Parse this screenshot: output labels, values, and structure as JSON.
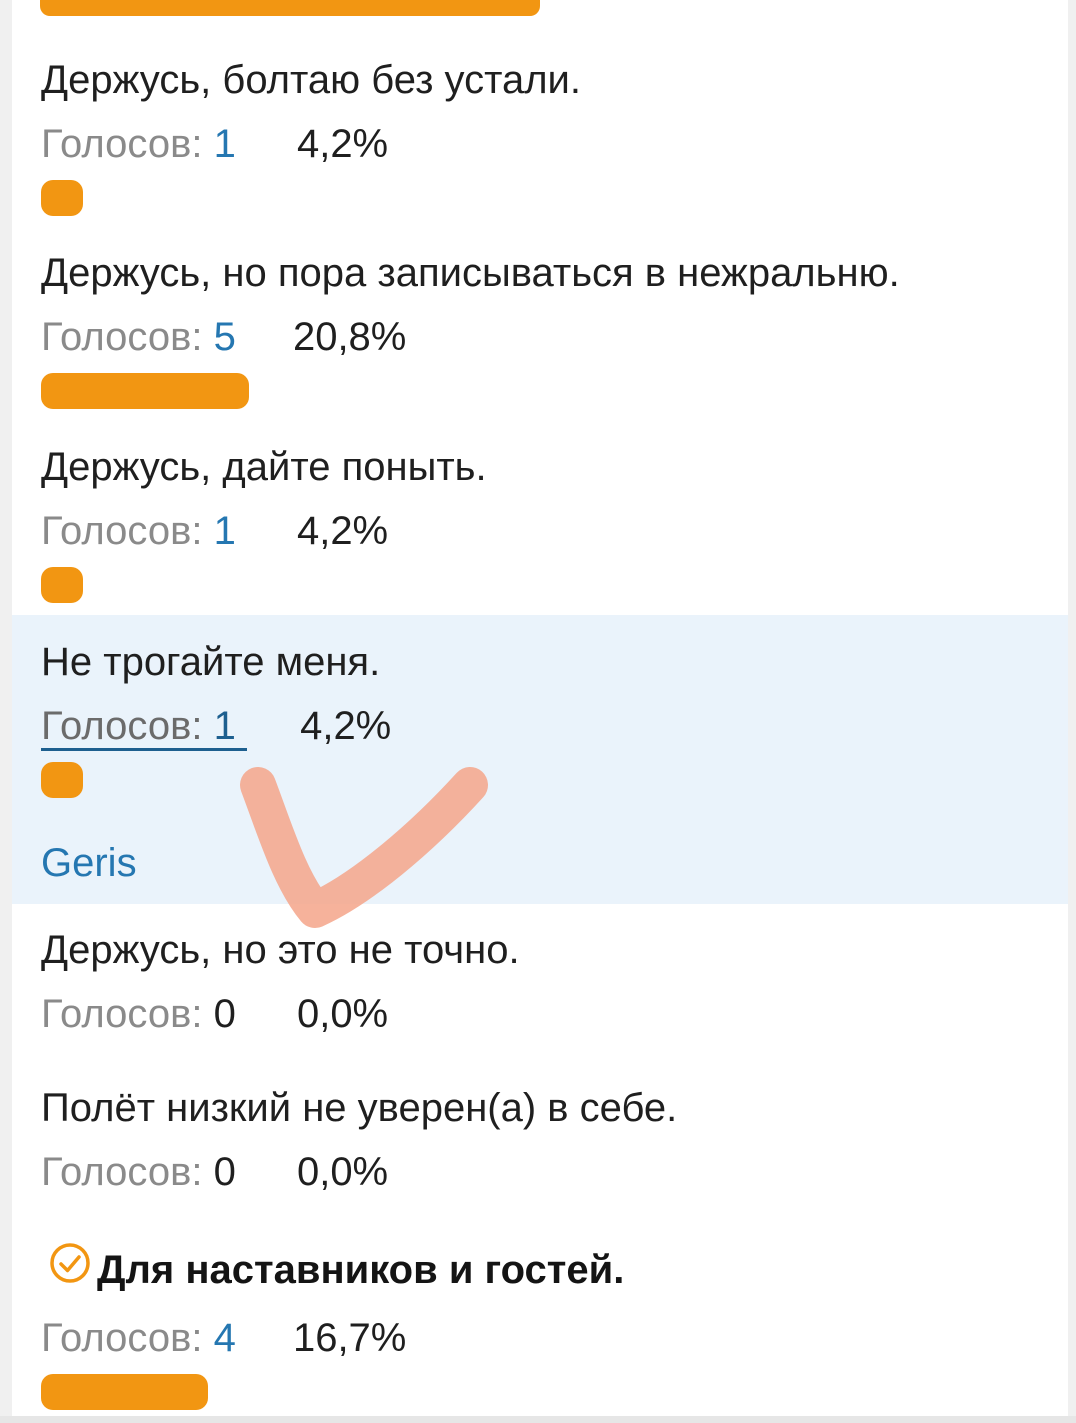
{
  "votes_label": "Голосов:",
  "options": [
    {
      "text": "Держусь, болтаю без устали.",
      "votes": "1",
      "percent": "4,2%",
      "fraction": 0.042
    },
    {
      "text": "Держусь, но пора записываться в нежральню.",
      "votes": "5",
      "percent": "20,8%",
      "fraction": 0.208
    },
    {
      "text": "Держусь, дайте поныть.",
      "votes": "1",
      "percent": "4,2%",
      "fraction": 0.042
    },
    {
      "text": "Не трогайте меня.",
      "votes": "1",
      "percent": "4,2%",
      "fraction": 0.042,
      "voter": "Geris"
    },
    {
      "text": "Держусь, но это не точно.",
      "votes": "0",
      "percent": "0,0%",
      "fraction": 0
    },
    {
      "text": "Полёт низкий не уверен(а) в себе.",
      "votes": "0",
      "percent": "0,0%",
      "fraction": 0
    },
    {
      "text": "Для наставников и гостей.",
      "votes": "4",
      "percent": "16,7%",
      "fraction": 0.167
    }
  ],
  "colors": {
    "bar": "#f29612",
    "selected_bg": "#eaf3fb",
    "link": "#2577b1",
    "check_icon": "#f29612",
    "overlay_tick": "#f5a58a"
  },
  "icons": {
    "voted_mark": "checkmark-circle-icon",
    "overlay": "handdrawn-checkmark"
  }
}
